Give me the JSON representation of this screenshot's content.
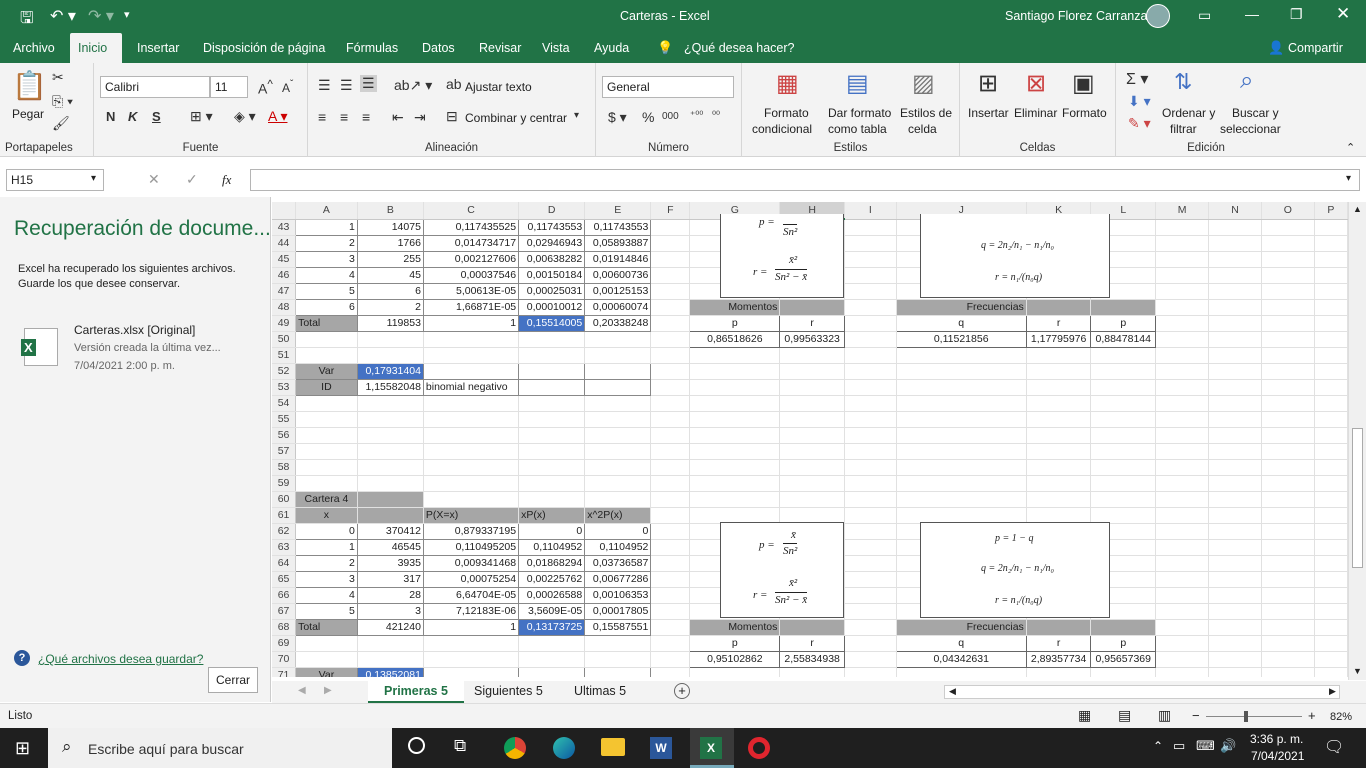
{
  "title": {
    "text": "Carteras  -  Excel",
    "user": "Santiago Florez Carranza"
  },
  "tabs": [
    "Archivo",
    "Inicio",
    "Insertar",
    "Disposición de página",
    "Fórmulas",
    "Datos",
    "Revisar",
    "Vista",
    "Ayuda",
    "¿Qué desea hacer?"
  ],
  "share_label": "Compartir",
  "ribbon": {
    "paste": "Pegar",
    "font_name": "Calibri",
    "font_size": "11",
    "wrap_text": "Ajustar texto",
    "merge": "Combinar y centrar",
    "number_format": "General",
    "cond_format": [
      "Formato",
      "condicional"
    ],
    "table_format": [
      "Dar formato",
      "como tabla"
    ],
    "cell_styles": [
      "Estilos de",
      "celda"
    ],
    "insert": "Insertar",
    "delete": "Eliminar",
    "format": "Formato",
    "sort": [
      "Ordenar y",
      "filtrar"
    ],
    "find": [
      "Buscar y",
      "seleccionar"
    ],
    "bold": "N",
    "italic": "K",
    "underline": "S",
    "groups": [
      "Portapapeles",
      "Fuente",
      "Alineación",
      "Número",
      "Estilos",
      "Celdas",
      "Edición"
    ]
  },
  "namebox": "H15",
  "fx": "fx",
  "recovery": {
    "title": "Recuperación de docume...",
    "msg1": "Excel ha recuperado los siguientes archivos.",
    "msg2": "Guarde los que desee conservar.",
    "file": "Carteras.xlsx  [Original]",
    "version": "Versión creada la última vez...",
    "date": "7/04/2021 2:00 p. m.",
    "help": "¿Qué archivos desea guardar?",
    "close": "Cerrar"
  },
  "columns": [
    "A",
    "B",
    "C",
    "D",
    "E",
    "F",
    "G",
    "H",
    "I",
    "J",
    "K",
    "L",
    "M",
    "N",
    "O",
    "P"
  ],
  "rows": [
    {
      "n": "43",
      "c": {
        "A": "1",
        "B": "14075",
        "C": "0,117435525",
        "D": "0,11743553",
        "E": "0,11743553"
      }
    },
    {
      "n": "44",
      "c": {
        "A": "2",
        "B": "1766",
        "C": "0,014734717",
        "D": "0,02946943",
        "E": "0,05893887"
      }
    },
    {
      "n": "45",
      "c": {
        "A": "3",
        "B": "255",
        "C": "0,002127606",
        "D": "0,00638282",
        "E": "0,01914846"
      }
    },
    {
      "n": "46",
      "c": {
        "A": "4",
        "B": "45",
        "C": "0,00037546",
        "D": "0,00150184",
        "E": "0,00600736"
      }
    },
    {
      "n": "47",
      "c": {
        "A": "5",
        "B": "6",
        "C": "5,00613E-05",
        "D": "0,00025031",
        "E": "0,00125153"
      }
    },
    {
      "n": "48",
      "c": {
        "A": "6",
        "B": "2",
        "C": "1,66871E-05",
        "D": "0,00010012",
        "E": "0,00060074",
        "G": "Momentos",
        "J": "Frecuencias"
      }
    },
    {
      "n": "49",
      "c": {
        "A": "Total",
        "B": "119853",
        "C": "1",
        "D": "0,15514005",
        "E": "0,20338248",
        "G": "p",
        "H": "r",
        "J": "q",
        "K": "r",
        "L": "p"
      }
    },
    {
      "n": "50",
      "c": {
        "G": "0,86518626",
        "H": "0,99563323",
        "J": "0,11521856",
        "K": "1,17795976",
        "L": "0,88478144"
      }
    },
    {
      "n": "51",
      "c": {}
    },
    {
      "n": "52",
      "c": {
        "A": "Var",
        "B": "0,17931404"
      }
    },
    {
      "n": "53",
      "c": {
        "A": "ID",
        "B": "1,15582048",
        "C": "binomial negativo"
      }
    },
    {
      "n": "54",
      "c": {}
    },
    {
      "n": "55",
      "c": {}
    },
    {
      "n": "56",
      "c": {}
    },
    {
      "n": "57",
      "c": {}
    },
    {
      "n": "58",
      "c": {}
    },
    {
      "n": "59",
      "c": {}
    },
    {
      "n": "60",
      "c": {
        "A": "Cartera 4"
      }
    },
    {
      "n": "61",
      "c": {
        "A": "x",
        "C": "P(X=x)",
        "D": "xP(x)",
        "E": "x^2P(x)"
      }
    },
    {
      "n": "62",
      "c": {
        "A": "0",
        "B": "370412",
        "C": "0,879337195",
        "D": "0",
        "E": "0"
      }
    },
    {
      "n": "63",
      "c": {
        "A": "1",
        "B": "46545",
        "C": "0,110495205",
        "D": "0,1104952",
        "E": "0,1104952"
      }
    },
    {
      "n": "64",
      "c": {
        "A": "2",
        "B": "3935",
        "C": "0,009341468",
        "D": "0,01868294",
        "E": "0,03736587"
      }
    },
    {
      "n": "65",
      "c": {
        "A": "3",
        "B": "317",
        "C": "0,00075254",
        "D": "0,00225762",
        "E": "0,00677286"
      }
    },
    {
      "n": "66",
      "c": {
        "A": "4",
        "B": "28",
        "C": "6,64704E-05",
        "D": "0,00026588",
        "E": "0,00106353"
      }
    },
    {
      "n": "67",
      "c": {
        "A": "5",
        "B": "3",
        "C": "7,12183E-06",
        "D": "3,5609E-05",
        "E": "0,00017805"
      }
    },
    {
      "n": "68",
      "c": {
        "A": "Total",
        "B": "421240",
        "C": "1",
        "D": "0,13173725",
        "E": "0,15587551",
        "G": "Momentos",
        "J": "Frecuencias"
      }
    },
    {
      "n": "69",
      "c": {
        "G": "p",
        "H": "r",
        "J": "q",
        "K": "r",
        "L": "p"
      }
    },
    {
      "n": "70",
      "c": {
        "G": "0,95102862",
        "H": "2,55834938",
        "J": "0,04342631",
        "K": "2,89357734",
        "L": "0,95657369"
      }
    },
    {
      "n": "71",
      "c": {
        "A": "Var",
        "B": "0,13852081"
      }
    }
  ],
  "formulas": {
    "p_mom": "p =",
    "xbar": "x̄",
    "sn2": "Sn²",
    "r_mom": "r =",
    "xbar2": "x̄²",
    "sn2_minus": "Sn² − x̄",
    "p_freq": "p = 1 − q",
    "q_freq": "q = 2n₂/n₁ − n₁/n₀",
    "r_freq": "r = n₁/(n₀q)"
  },
  "sheets": [
    "Primeras 5",
    "Siguientes 5",
    "Ultimas 5"
  ],
  "status": {
    "ready": "Listo",
    "zoom": "82%"
  },
  "taskbar": {
    "search": "Escribe aquí para buscar",
    "time": "3:36 p. m.",
    "date": "7/04/2021"
  },
  "colors": {
    "excel_green": "#217346",
    "highlight_blue": "#4472c4",
    "header_gray": "#a6a6a6"
  }
}
